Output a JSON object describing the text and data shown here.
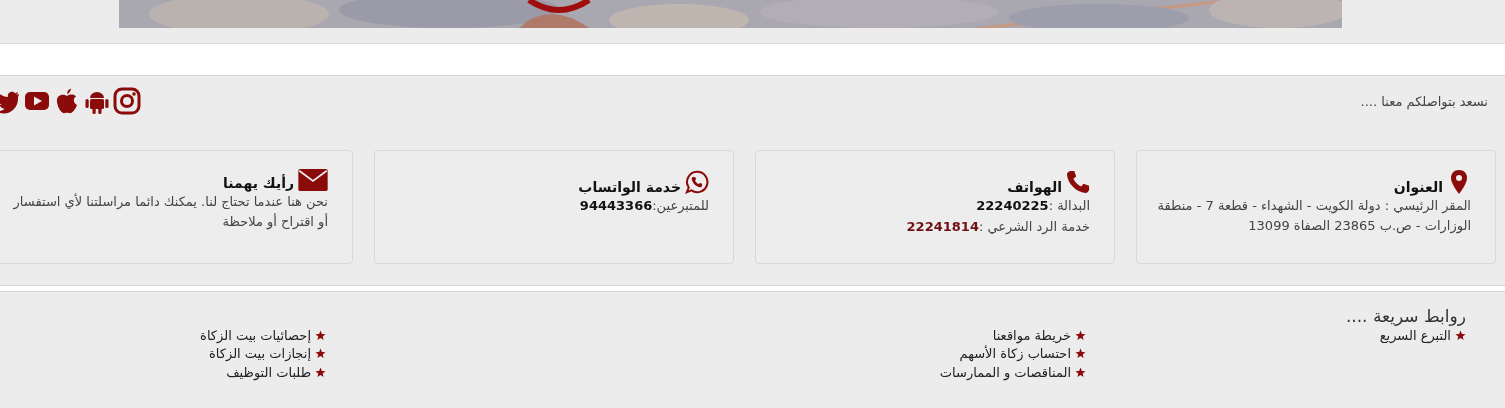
{
  "contact": {
    "tagline": "نسعد بتواصلكم معنا ....",
    "social": [
      {
        "kind": "instagram"
      },
      {
        "kind": "android"
      },
      {
        "kind": "apple"
      },
      {
        "kind": "youtube"
      },
      {
        "kind": "twitter"
      }
    ],
    "cards": [
      {
        "kind": "pin",
        "title": "العنوان",
        "lines": [
          {
            "text": "المقر الرئيسي : دولة الكويت - الشهداء - قطعة 7 - منطقة الوزارات - ص.ب 23865 الصفاة 13099"
          }
        ]
      },
      {
        "kind": "phone",
        "title": "الهواتف",
        "lines": [
          {
            "text": "البدالة :",
            "value": "22240225",
            "highlighted": false
          },
          {
            "text": "خدمة الرد الشرعي :",
            "value": "22241814",
            "highlighted": true
          }
        ]
      },
      {
        "kind": "whatsapp",
        "title": "خدمة الواتساب",
        "lines": [
          {
            "text": "للمتبرعين:",
            "value": "94443366",
            "highlighted": false
          }
        ]
      },
      {
        "kind": "mail",
        "title": "رأيك يهمنا",
        "lines": [
          {
            "text": "نحن هنا عندما تحتاج لنا. يمكنك دائما مراسلتنا لأي استفسار أو اقتراح أو ملاحظة"
          }
        ]
      }
    ]
  },
  "quick_links": {
    "title": "روابط سريعة ....",
    "groups": [
      {
        "items": [
          "التبرع السريع"
        ]
      },
      {
        "items": [
          "خريطة مواقعنا",
          "احتساب زكاة الأسهم",
          "المناقصات و الممارسات"
        ]
      },
      {
        "items": [
          "إحصائيات بيت الزكاة",
          "إنجازات بيت الزكاة",
          "طلبات التوظيف"
        ]
      }
    ]
  }
}
